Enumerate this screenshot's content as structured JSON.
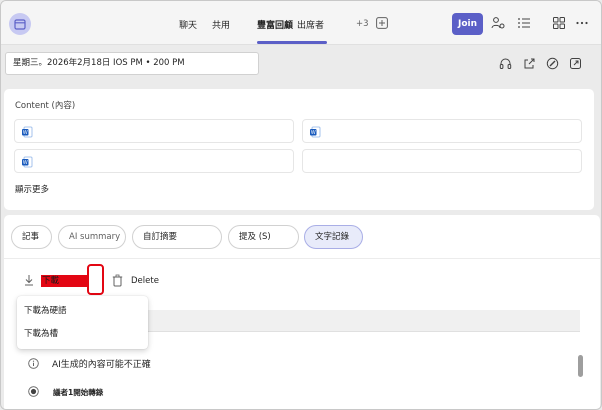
{
  "header": {
    "tabs": [
      {
        "label": "聊天"
      },
      {
        "label": "共用"
      },
      {
        "label": "豐富回顧"
      },
      {
        "label": "出席者"
      }
    ],
    "overflow_count": "+3",
    "join_label": "Join"
  },
  "meeting": {
    "date_time": "星期三。2026年2月18日 IOS PM • 200 PM"
  },
  "content": {
    "title": "Content (內容)",
    "show_more": "顯示更多"
  },
  "recap": {
    "pills": [
      {
        "label": "記事"
      },
      {
        "label": "AI summary"
      },
      {
        "label": "自訂摘要"
      },
      {
        "label": "提及 (S)"
      },
      {
        "label": "文字記錄"
      }
    ],
    "download_label": "下載",
    "delete_label": "Delete",
    "download_menu": [
      {
        "label": "下載為硬語"
      },
      {
        "label": "下載為槽"
      }
    ],
    "ai_note": "AI生成的內容可能不正確",
    "speaker_line": "議者1開始轉錄"
  },
  "colors": {
    "accent": "#5b5fc7",
    "highlight": "#e30613"
  }
}
